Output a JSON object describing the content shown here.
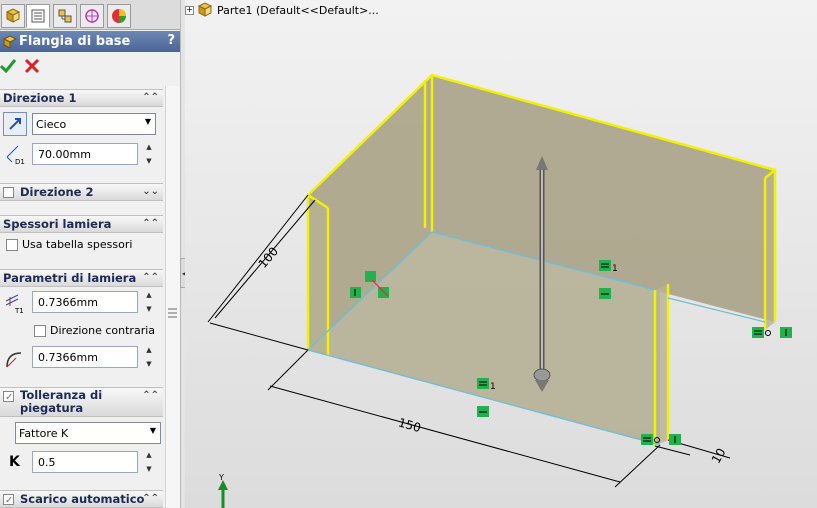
{
  "tabs": [
    "feature-manager-icon",
    "property-manager-icon",
    "configuration-manager-icon",
    "dimxpert-icon",
    "display-manager-icon"
  ],
  "property_manager": {
    "title": "Flangia di base",
    "help": "?",
    "groups": {
      "direction1": {
        "title": "Direzione 1",
        "end_condition": "Cieco",
        "depth_value": "70.00mm"
      },
      "direction2": {
        "title": "Direzione 2"
      },
      "sheet_gauges": {
        "title": "Spessori lamiera",
        "use_gauge_table": "Usa tabella spessori"
      },
      "sheet_metal_params": {
        "title": "Parametri di lamiera",
        "thickness": "0.7366mm",
        "reverse_direction": "Direzione contraria",
        "bend_radius": "0.7366mm"
      },
      "bend_allowance": {
        "title": "Tolleranza di piegatura",
        "type": "Fattore K",
        "k_label": "K",
        "k_value": "0.5"
      },
      "auto_relief": {
        "title": "Scarico automatico"
      }
    },
    "icon_labels": {
      "d1": "D1",
      "t1": "T1"
    }
  },
  "viewport": {
    "tree_text": "Parte1  (Default<<Default>...",
    "dimensions": {
      "depth": "100",
      "width": "150",
      "thickness": "10"
    },
    "relation_index": "1",
    "triad_y": "Y"
  },
  "colors": {
    "title_bar": "#5a74a6",
    "edge_highlight": "#f2f200",
    "face": "#a9a48a",
    "relation": "#22b14c"
  }
}
